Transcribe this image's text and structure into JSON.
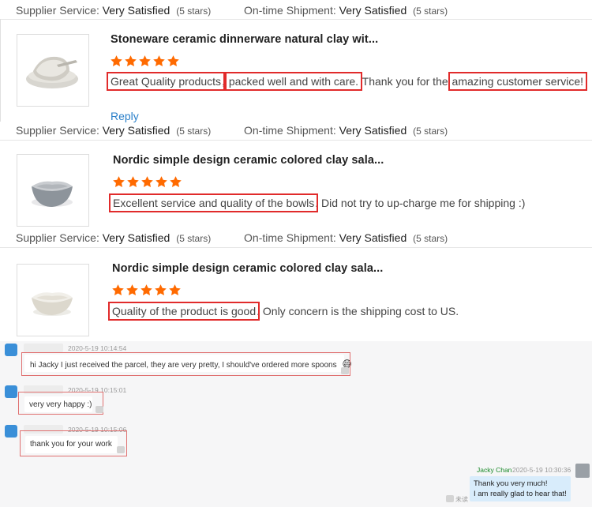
{
  "meta_labels": {
    "supplier_service": "Supplier Service:",
    "on_time_shipment": "On-time Shipment:"
  },
  "reviews": [
    {
      "rating_text": {
        "supplier_value": "Very Satisfied",
        "supplier_stars": "(5 stars)",
        "shipment_value": "Very Satisfied",
        "shipment_stars": "(5 stars)"
      },
      "product_title": "Stoneware ceramic dinnerware natural clay wit...",
      "stars": 5,
      "review_parts": [
        "Great Quality products",
        ", ",
        "packed well and with care.",
        " Thank you for the ",
        "amazing customer service!"
      ],
      "reply_label": "Reply"
    },
    {
      "rating_text": {
        "supplier_value": "Very Satisfied",
        "supplier_stars": "(5 stars)",
        "shipment_value": "Very Satisfied",
        "shipment_stars": "(5 stars)"
      },
      "product_title": "Nordic simple design ceramic colored clay sala...",
      "stars": 5,
      "review_parts": [
        "Excellent service and quality of the bowls",
        ". Did not try to up-charge me for shipping :)"
      ]
    },
    {
      "rating_text": {
        "supplier_value": "Very Satisfied",
        "supplier_stars": "(5 stars)",
        "shipment_value": "Very Satisfied",
        "shipment_stars": "(5 stars)"
      },
      "product_title": "Nordic simple design ceramic colored clay sala...",
      "stars": 5,
      "review_parts": [
        "Quality of the product is good",
        ". Only concern is the shipping cost to US."
      ]
    }
  ],
  "chat": {
    "messages": [
      {
        "timestamp": "2020-5-19 10:14:54",
        "text": "hi Jacky I just received the parcel, they are very pretty, I should've ordered more spoons",
        "emoji": "😅"
      },
      {
        "timestamp": "2020-5-19 10:15:01",
        "text": "very very happy :)"
      },
      {
        "timestamp": "2020-5-19 10:15:06",
        "text": "thank you for your work"
      }
    ],
    "reply": {
      "sender": "Jacky Chan",
      "timestamp": "2020-5-19 10:30:36",
      "lines": [
        "Thank you very much!",
        "I am really glad to hear that!"
      ],
      "status": "未读"
    }
  },
  "colors": {
    "star": "#ff6a00",
    "highlight_box": "#e12b2b",
    "reply_link": "#2a7fc9",
    "chat_bg": "#f6f6f7",
    "reply_bubble": "#d8ecfb"
  }
}
